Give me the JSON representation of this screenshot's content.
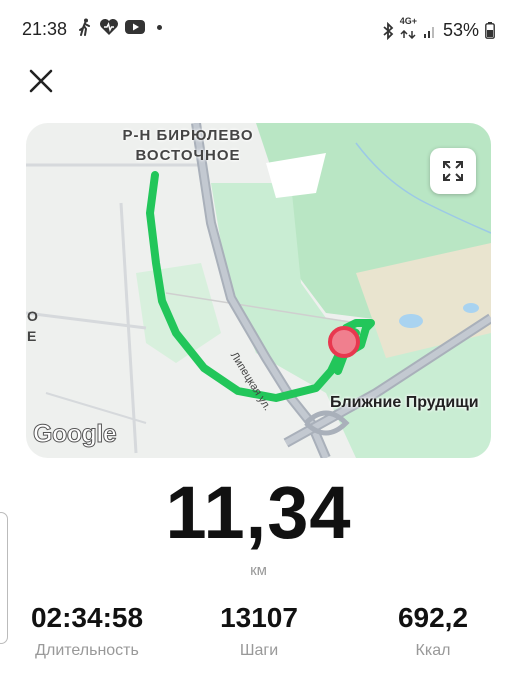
{
  "status_bar": {
    "time": "21:38",
    "network": "4G+",
    "battery": "53%"
  },
  "map": {
    "district_label": "Р-Н БИРЮЛЕВО ВОСТОЧНОЕ",
    "suburb_label": "Ближние Прудищи",
    "street_label": "Липецкая ул.",
    "edge_label_1": "О",
    "edge_label_2": "Е",
    "google_logo": "Google",
    "colors": {
      "route": "#22c65a",
      "marker": "#e8384f",
      "park": "#b9e6c4"
    }
  },
  "workout": {
    "distance": "11,34",
    "distance_unit": "км",
    "duration": "02:34:58",
    "duration_label": "Длительность",
    "steps": "13107",
    "steps_label": "Шаги",
    "kcal": "692,2",
    "kcal_label": "Ккал"
  },
  "icons": [
    "walk-icon",
    "heart-icon",
    "youtube-icon",
    "bluetooth-icon",
    "signal-icon",
    "battery-icon",
    "close-icon",
    "expand-icon"
  ]
}
